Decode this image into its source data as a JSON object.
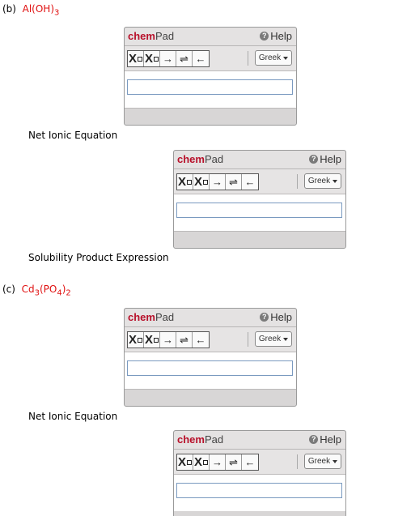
{
  "part_b": {
    "label": "(b)",
    "formula": "Al(OH)",
    "sub": "3"
  },
  "part_c": {
    "label": "(c)",
    "formula_a": "Cd",
    "sub_a": "3",
    "formula_b": "(PO",
    "sub_b": "4",
    "formula_c": ")",
    "sub_c": "2"
  },
  "captions": {
    "net_ionic": "Net Ionic Equation",
    "solubility": "Solubility Product Expression"
  },
  "chempad": {
    "title_a": "chem",
    "title_b": "Pad",
    "help_label": "Help",
    "help_glyph": "?",
    "greek_label": "Greek",
    "btn_sub": "X",
    "btn_sup": "X",
    "btn_arrow": "→",
    "btn_equilibrium": "⇌",
    "btn_back": "←"
  },
  "colors": {
    "formula_red": "#e01010",
    "chem_red": "#b8102a",
    "input_border": "#7a9ac0"
  }
}
